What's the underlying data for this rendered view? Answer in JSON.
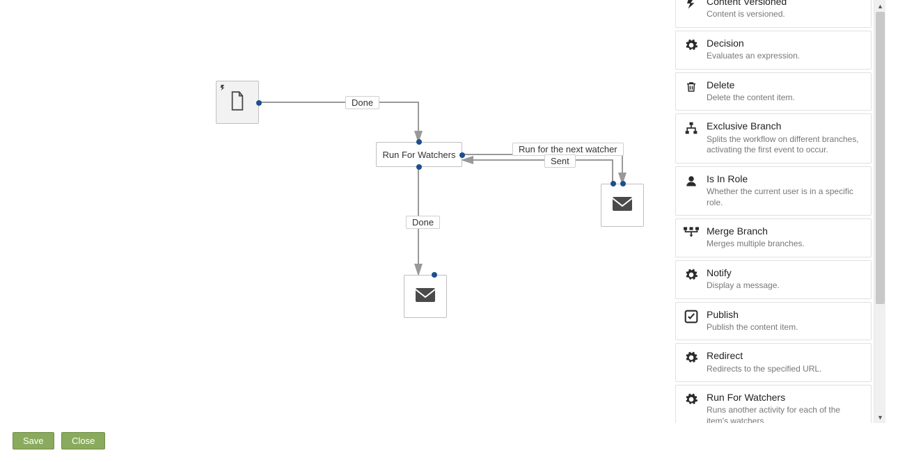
{
  "canvas": {
    "node_runfor_label": "Run For Watchers",
    "edge_done_1": "Done",
    "edge_done_2": "Done",
    "edge_runfor_next": "Run for the next watcher",
    "edge_sent": "Sent"
  },
  "sidebar": {
    "items": [
      {
        "icon": "bolt-icon",
        "title": "Content Versioned",
        "desc": "Content is versioned."
      },
      {
        "icon": "gear-icon",
        "title": "Decision",
        "desc": "Evaluates an expression."
      },
      {
        "icon": "trash-icon",
        "title": "Delete",
        "desc": "Delete the content item."
      },
      {
        "icon": "sitemap-icon",
        "title": "Exclusive Branch",
        "desc": "Splits the workflow on different branches, activating the first event to occur."
      },
      {
        "icon": "user-icon",
        "title": "Is In Role",
        "desc": "Whether the current user is in a specific role."
      },
      {
        "icon": "merge-icon",
        "title": "Merge Branch",
        "desc": "Merges multiple branches."
      },
      {
        "icon": "gear-icon",
        "title": "Notify",
        "desc": "Display a message."
      },
      {
        "icon": "check-icon",
        "title": "Publish",
        "desc": "Publish the content item."
      },
      {
        "icon": "gear-icon",
        "title": "Redirect",
        "desc": "Redirects to the specified URL."
      },
      {
        "icon": "gear-icon",
        "title": "Run For Watchers",
        "desc": "Runs another activity for each of the item's watchers"
      }
    ]
  },
  "footer": {
    "save_label": "Save",
    "close_label": "Close"
  }
}
